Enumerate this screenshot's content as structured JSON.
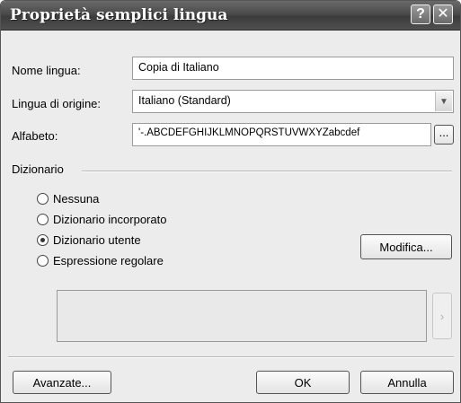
{
  "window": {
    "title": "Proprietà semplici lingua",
    "help_icon": "?",
    "close_icon": "✕"
  },
  "form": {
    "name_label": "Nome lingua:",
    "name_value": "Copia di Italiano",
    "source_label": "Lingua di origine:",
    "source_value": "Italiano (Standard)",
    "source_arrow": "▼",
    "alphabet_label": "Alfabeto:",
    "alphabet_value": "'-.ABCDEFGHIJKLMNOPQRSTUVWXYZabcdef",
    "alphabet_button": "..."
  },
  "dictionary": {
    "group_label": "Dizionario",
    "options": [
      {
        "label": "Nessuna",
        "selected": false
      },
      {
        "label": "Dizionario incorporato",
        "selected": false
      },
      {
        "label": "Dizionario utente",
        "selected": true
      },
      {
        "label": "Espressione regolare",
        "selected": false
      }
    ],
    "edit_button": "Modifica...",
    "side_arrow": "›"
  },
  "footer": {
    "advanced_button": "Avanzate...",
    "ok_button": "OK",
    "cancel_button": "Annulla"
  }
}
